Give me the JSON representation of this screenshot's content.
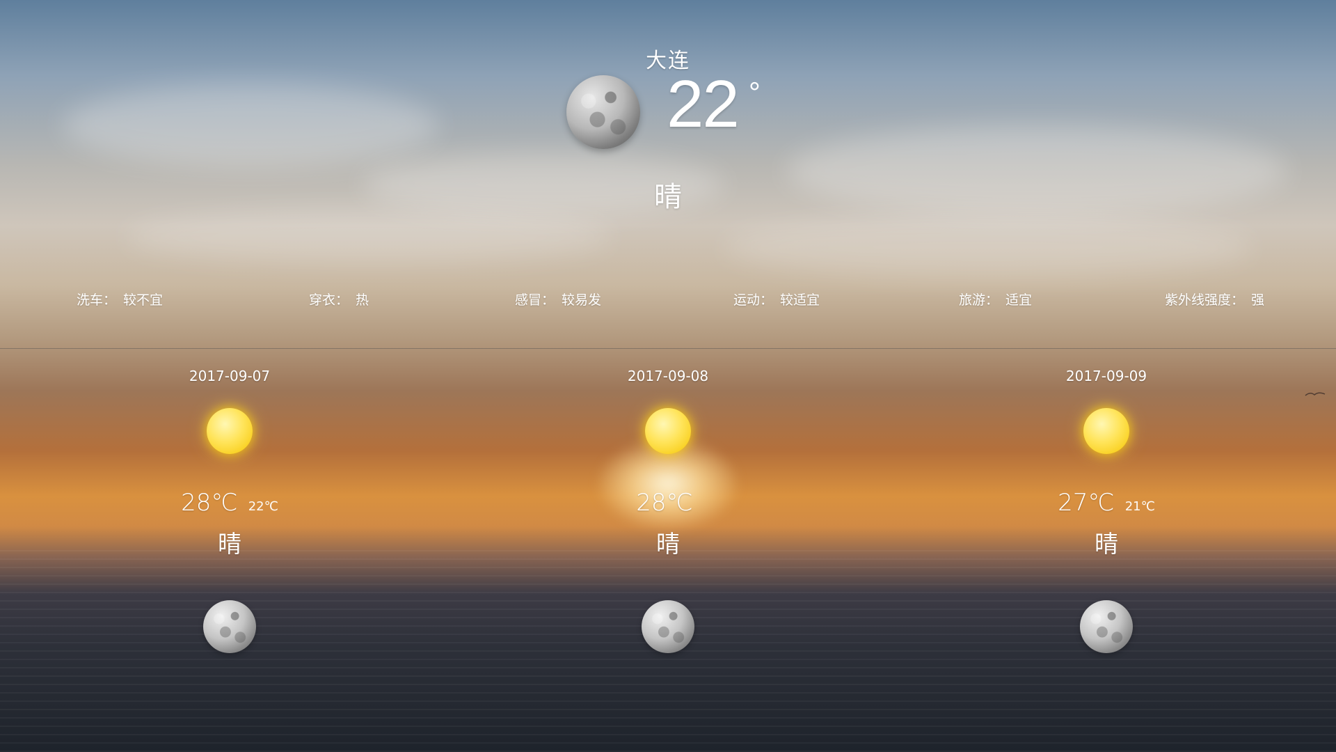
{
  "city": "大连",
  "current": {
    "temperature": "22",
    "unit": "°",
    "condition": "晴",
    "icon": "moon-icon"
  },
  "indices": [
    {
      "label": "洗车：",
      "value": "较不宜"
    },
    {
      "label": "穿衣：",
      "value": "热"
    },
    {
      "label": "感冒：",
      "value": "较易发"
    },
    {
      "label": "运动：",
      "value": "较适宜"
    },
    {
      "label": "旅游：",
      "value": "适宜"
    },
    {
      "label": "紫外线强度：",
      "value": "强"
    }
  ],
  "forecast": [
    {
      "date": "2017-09-07",
      "day_icon": "sun-icon",
      "high": "28℃",
      "low": "22℃",
      "condition": "晴",
      "night_icon": "moon-icon"
    },
    {
      "date": "2017-09-08",
      "day_icon": "sun-icon",
      "high": "28℃",
      "low": "",
      "condition": "晴",
      "night_icon": "moon-icon"
    },
    {
      "date": "2017-09-09",
      "day_icon": "sun-icon",
      "high": "27℃",
      "low": "21℃",
      "condition": "晴",
      "night_icon": "moon-icon"
    }
  ],
  "colors": {
    "text": "#ffffff",
    "sun": "#f6c500",
    "moon": "#a8a8a8"
  }
}
